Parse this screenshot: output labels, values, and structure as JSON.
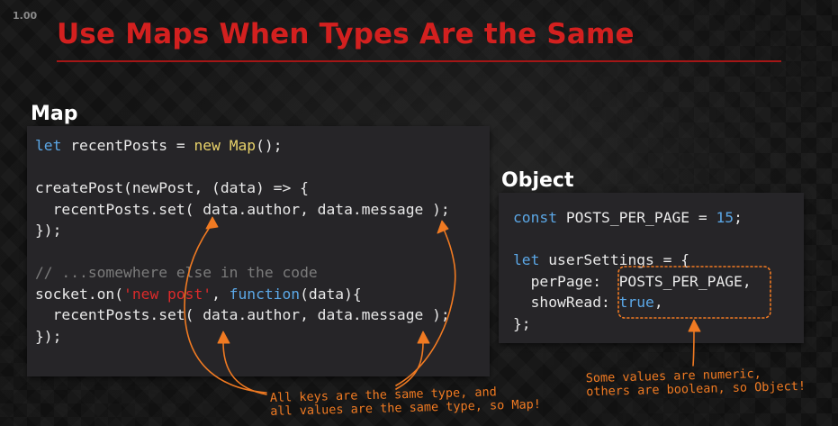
{
  "playback": {
    "speed": "1.00"
  },
  "slide": {
    "title": "Use Maps When Types Are the Same",
    "map_label": "Map",
    "object_label": "Object"
  },
  "map_code": {
    "line1": {
      "kw": "let",
      "text1": " recentPosts = ",
      "kw2": "new",
      "space": " ",
      "fn": "Map",
      "text2": "();"
    },
    "line3": {
      "text": "createPost(newPost, (data) => {"
    },
    "line4": {
      "text": "  recentPosts.set( data.author, data.message );"
    },
    "line5": {
      "text": "});"
    },
    "line7": {
      "comment": "// ...somewhere else in the code"
    },
    "line8": {
      "text1": "socket.on(",
      "str": "'new post'",
      "text2": ", ",
      "kw": "function",
      "text3": "(data){"
    },
    "line9": {
      "text": "  recentPosts.set( data.author, data.message );"
    },
    "line10": {
      "text": "});"
    }
  },
  "object_code": {
    "line1": {
      "kw": "const",
      "text1": " POSTS_PER_PAGE = ",
      "num": "15",
      "text2": ";"
    },
    "line3": {
      "kw": "let",
      "text1": " userSettings = {"
    },
    "line4": {
      "text": "  perPage:  POSTS_PER_PAGE,"
    },
    "line5": {
      "text1": "  showRead: ",
      "kw": "true",
      "text2": ","
    },
    "line6": {
      "text": "};"
    }
  },
  "annotations": {
    "map_note_line1": "All keys are the same type, and",
    "map_note_line2": "all values are the same type, so Map!",
    "object_note_line1": "Some values are numeric,",
    "object_note_line2": "others are boolean, so Object!"
  },
  "colors": {
    "title": "#d3201f",
    "keyword": "#5ba7e6",
    "function": "#e8d26a",
    "string": "#dc2a2a",
    "comment": "#7b7b7b",
    "annotation": "#f07a22"
  }
}
